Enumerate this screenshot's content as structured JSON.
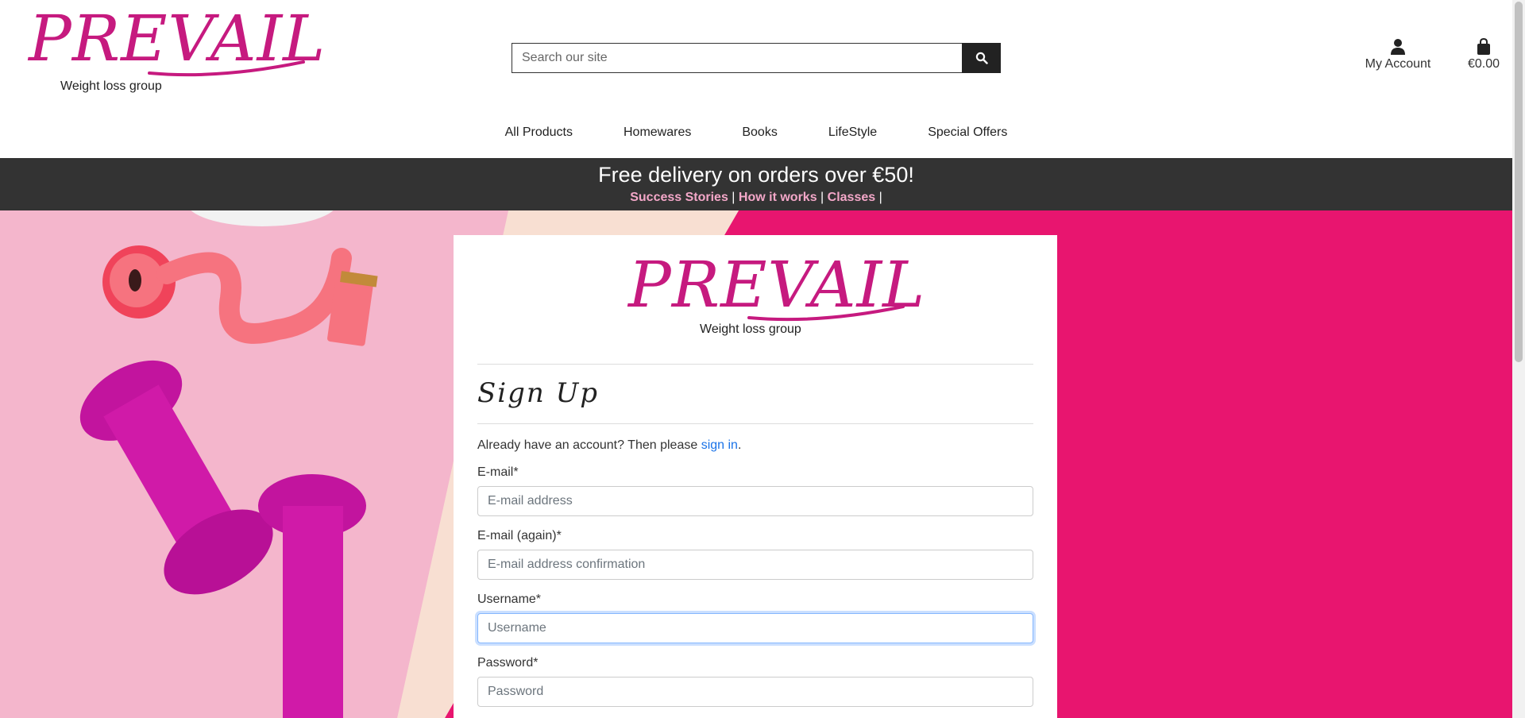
{
  "brand": {
    "name": "PREVAIL",
    "tagline": "Weight loss group",
    "color": "#c61a7f"
  },
  "search": {
    "placeholder": "Search our site"
  },
  "header": {
    "account_label": "My Account",
    "cart_total": "€0.00"
  },
  "nav": {
    "items": [
      "All Products",
      "Homewares",
      "Books",
      "LifeStyle",
      "Special Offers"
    ]
  },
  "banner": {
    "title": "Free delivery on orders over €50!",
    "links": [
      "Success Stories",
      "How it works",
      "Classes"
    ],
    "separator": "|"
  },
  "signup": {
    "title": "Sign Up",
    "lead_prefix": "Already have an account? Then please",
    "lead_link": "sign in",
    "lead_suffix": ".",
    "fields": [
      {
        "label": "E-mail*",
        "placeholder": "E-mail address"
      },
      {
        "label": "E-mail (again)*",
        "placeholder": "E-mail address confirmation"
      },
      {
        "label": "Username*",
        "placeholder": "Username"
      },
      {
        "label": "Password*",
        "placeholder": "Password"
      }
    ]
  },
  "icons": {
    "search": "search-icon",
    "account": "user-icon",
    "cart": "shopping-bag-icon"
  },
  "colors": {
    "banner_bg": "#333333",
    "banner_link": "#f3a7c8",
    "hero_pink": "#e8156f",
    "link_blue": "#1a73e8"
  }
}
